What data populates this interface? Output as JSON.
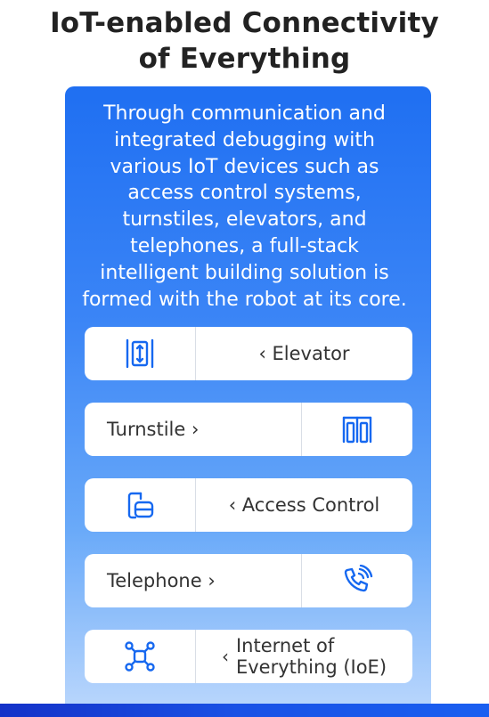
{
  "title": "IoT-enabled Connectivity\nof Everything",
  "description": "Through communication and\nintegrated debugging with\nvarious IoT devices such as\naccess control systems,\nturnstiles, elevators, and\ntelephones, a full-stack\nintelligent building solution is\nformed with the robot at its core.",
  "colors": {
    "accent": "#1f6ff2",
    "icon": "#1668f0",
    "text": "#333333",
    "title": "#222222"
  },
  "items": [
    {
      "label": "‹ Elevator",
      "icon": "elevator-icon",
      "icon_side": "left"
    },
    {
      "label": "Turnstile ›",
      "icon": "turnstile-icon",
      "icon_side": "right"
    },
    {
      "label": "‹ Access Control",
      "icon": "access-control-icon",
      "icon_side": "left"
    },
    {
      "label": "Telephone ›",
      "icon": "telephone-icon",
      "icon_side": "right"
    },
    {
      "label_chevron": "‹",
      "label": "Internet of\nEverything (IoE)",
      "icon": "ioe-network-icon",
      "icon_side": "left"
    }
  ]
}
